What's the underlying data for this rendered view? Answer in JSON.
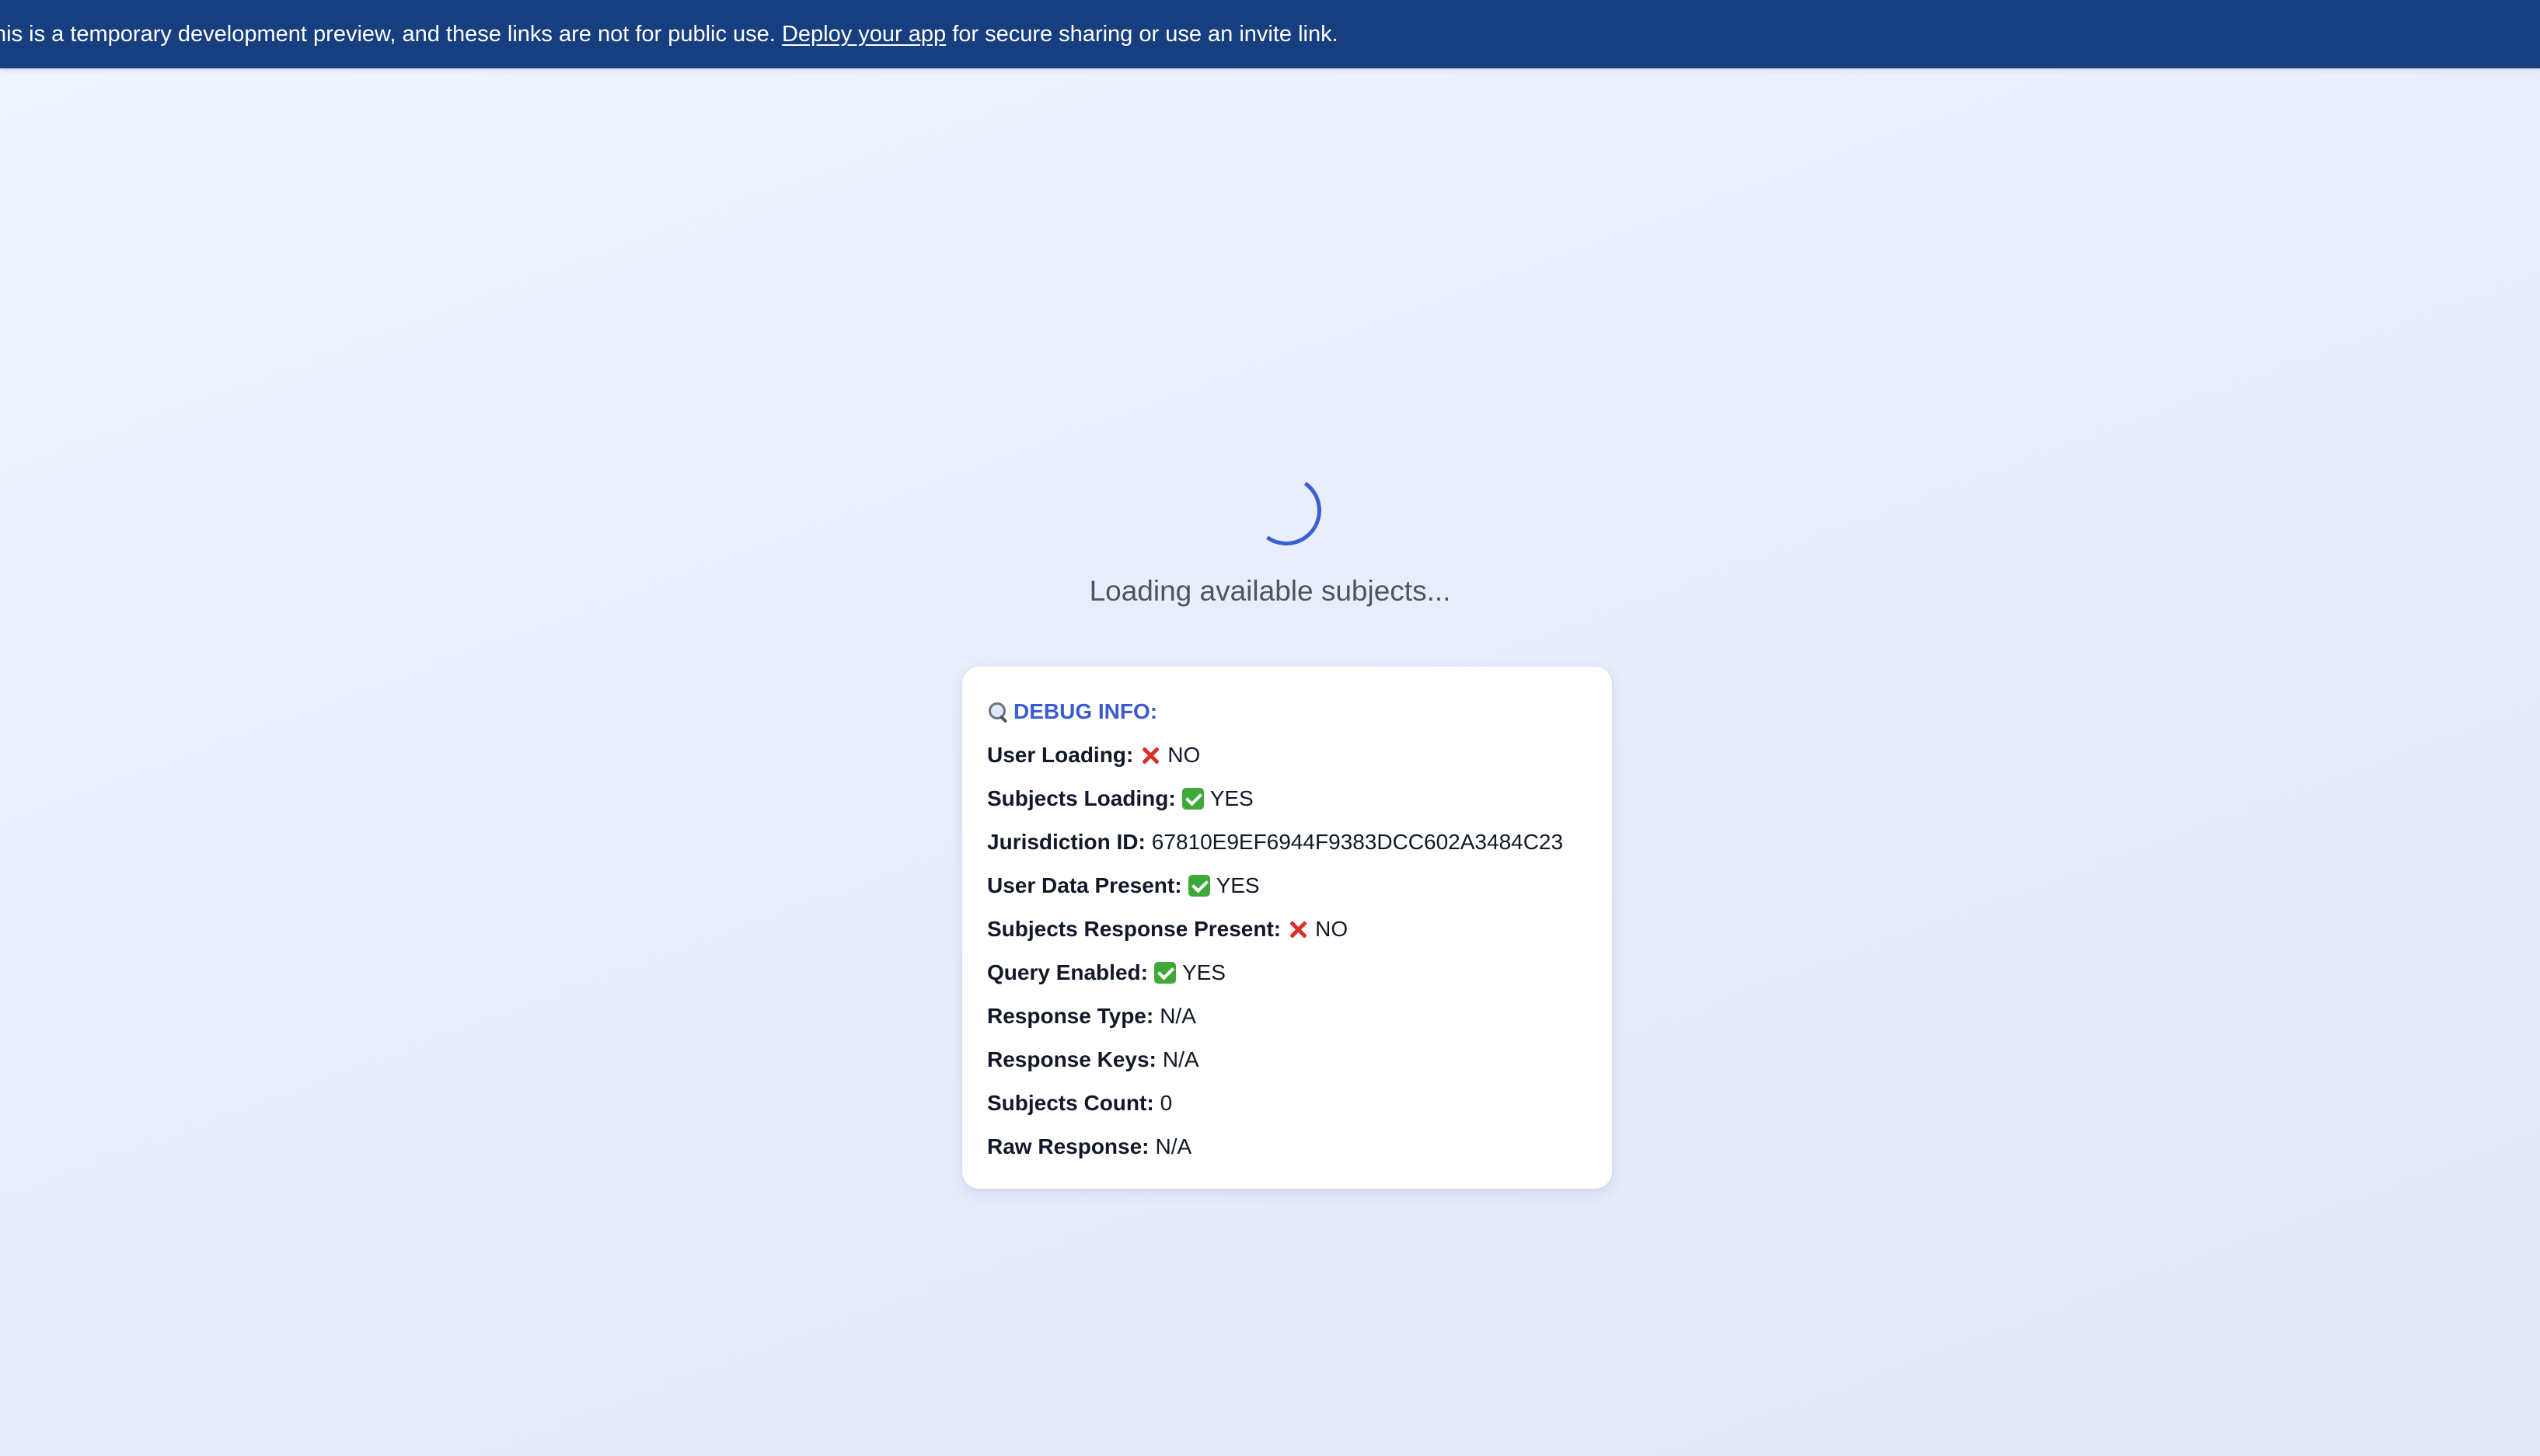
{
  "banner": {
    "text_before": "his is a temporary development preview, and these links are not for public use.",
    "link_label": "Deploy your app",
    "text_after": "for secure sharing or use an invite link."
  },
  "loading": {
    "text": "Loading available subjects..."
  },
  "debug": {
    "title": "DEBUG INFO:",
    "rows": [
      {
        "label": "User Loading:",
        "icon": "cross-mark-icon",
        "value": "NO"
      },
      {
        "label": "Subjects Loading:",
        "icon": "check-mark-icon",
        "value": "YES"
      },
      {
        "label": "Jurisdiction ID:",
        "icon": "",
        "value": "67810E9EF6944F9383DCC602A3484C23"
      },
      {
        "label": "User Data Present:",
        "icon": "check-mark-icon",
        "value": "YES"
      },
      {
        "label": "Subjects Response Present:",
        "icon": "cross-mark-icon",
        "value": "NO"
      },
      {
        "label": "Query Enabled:",
        "icon": "check-mark-icon",
        "value": "YES"
      },
      {
        "label": "Response Type:",
        "icon": "",
        "value": "N/A"
      },
      {
        "label": "Response Keys:",
        "icon": "",
        "value": "N/A"
      },
      {
        "label": "Subjects Count:",
        "icon": "",
        "value": "0"
      },
      {
        "label": "Raw Response:",
        "icon": "",
        "value": "N/A"
      }
    ]
  },
  "colors": {
    "banner_bg": "#173e7f",
    "accent": "#3b5bd1",
    "yes_green": "#3fa83a",
    "no_red": "#d9302c"
  }
}
